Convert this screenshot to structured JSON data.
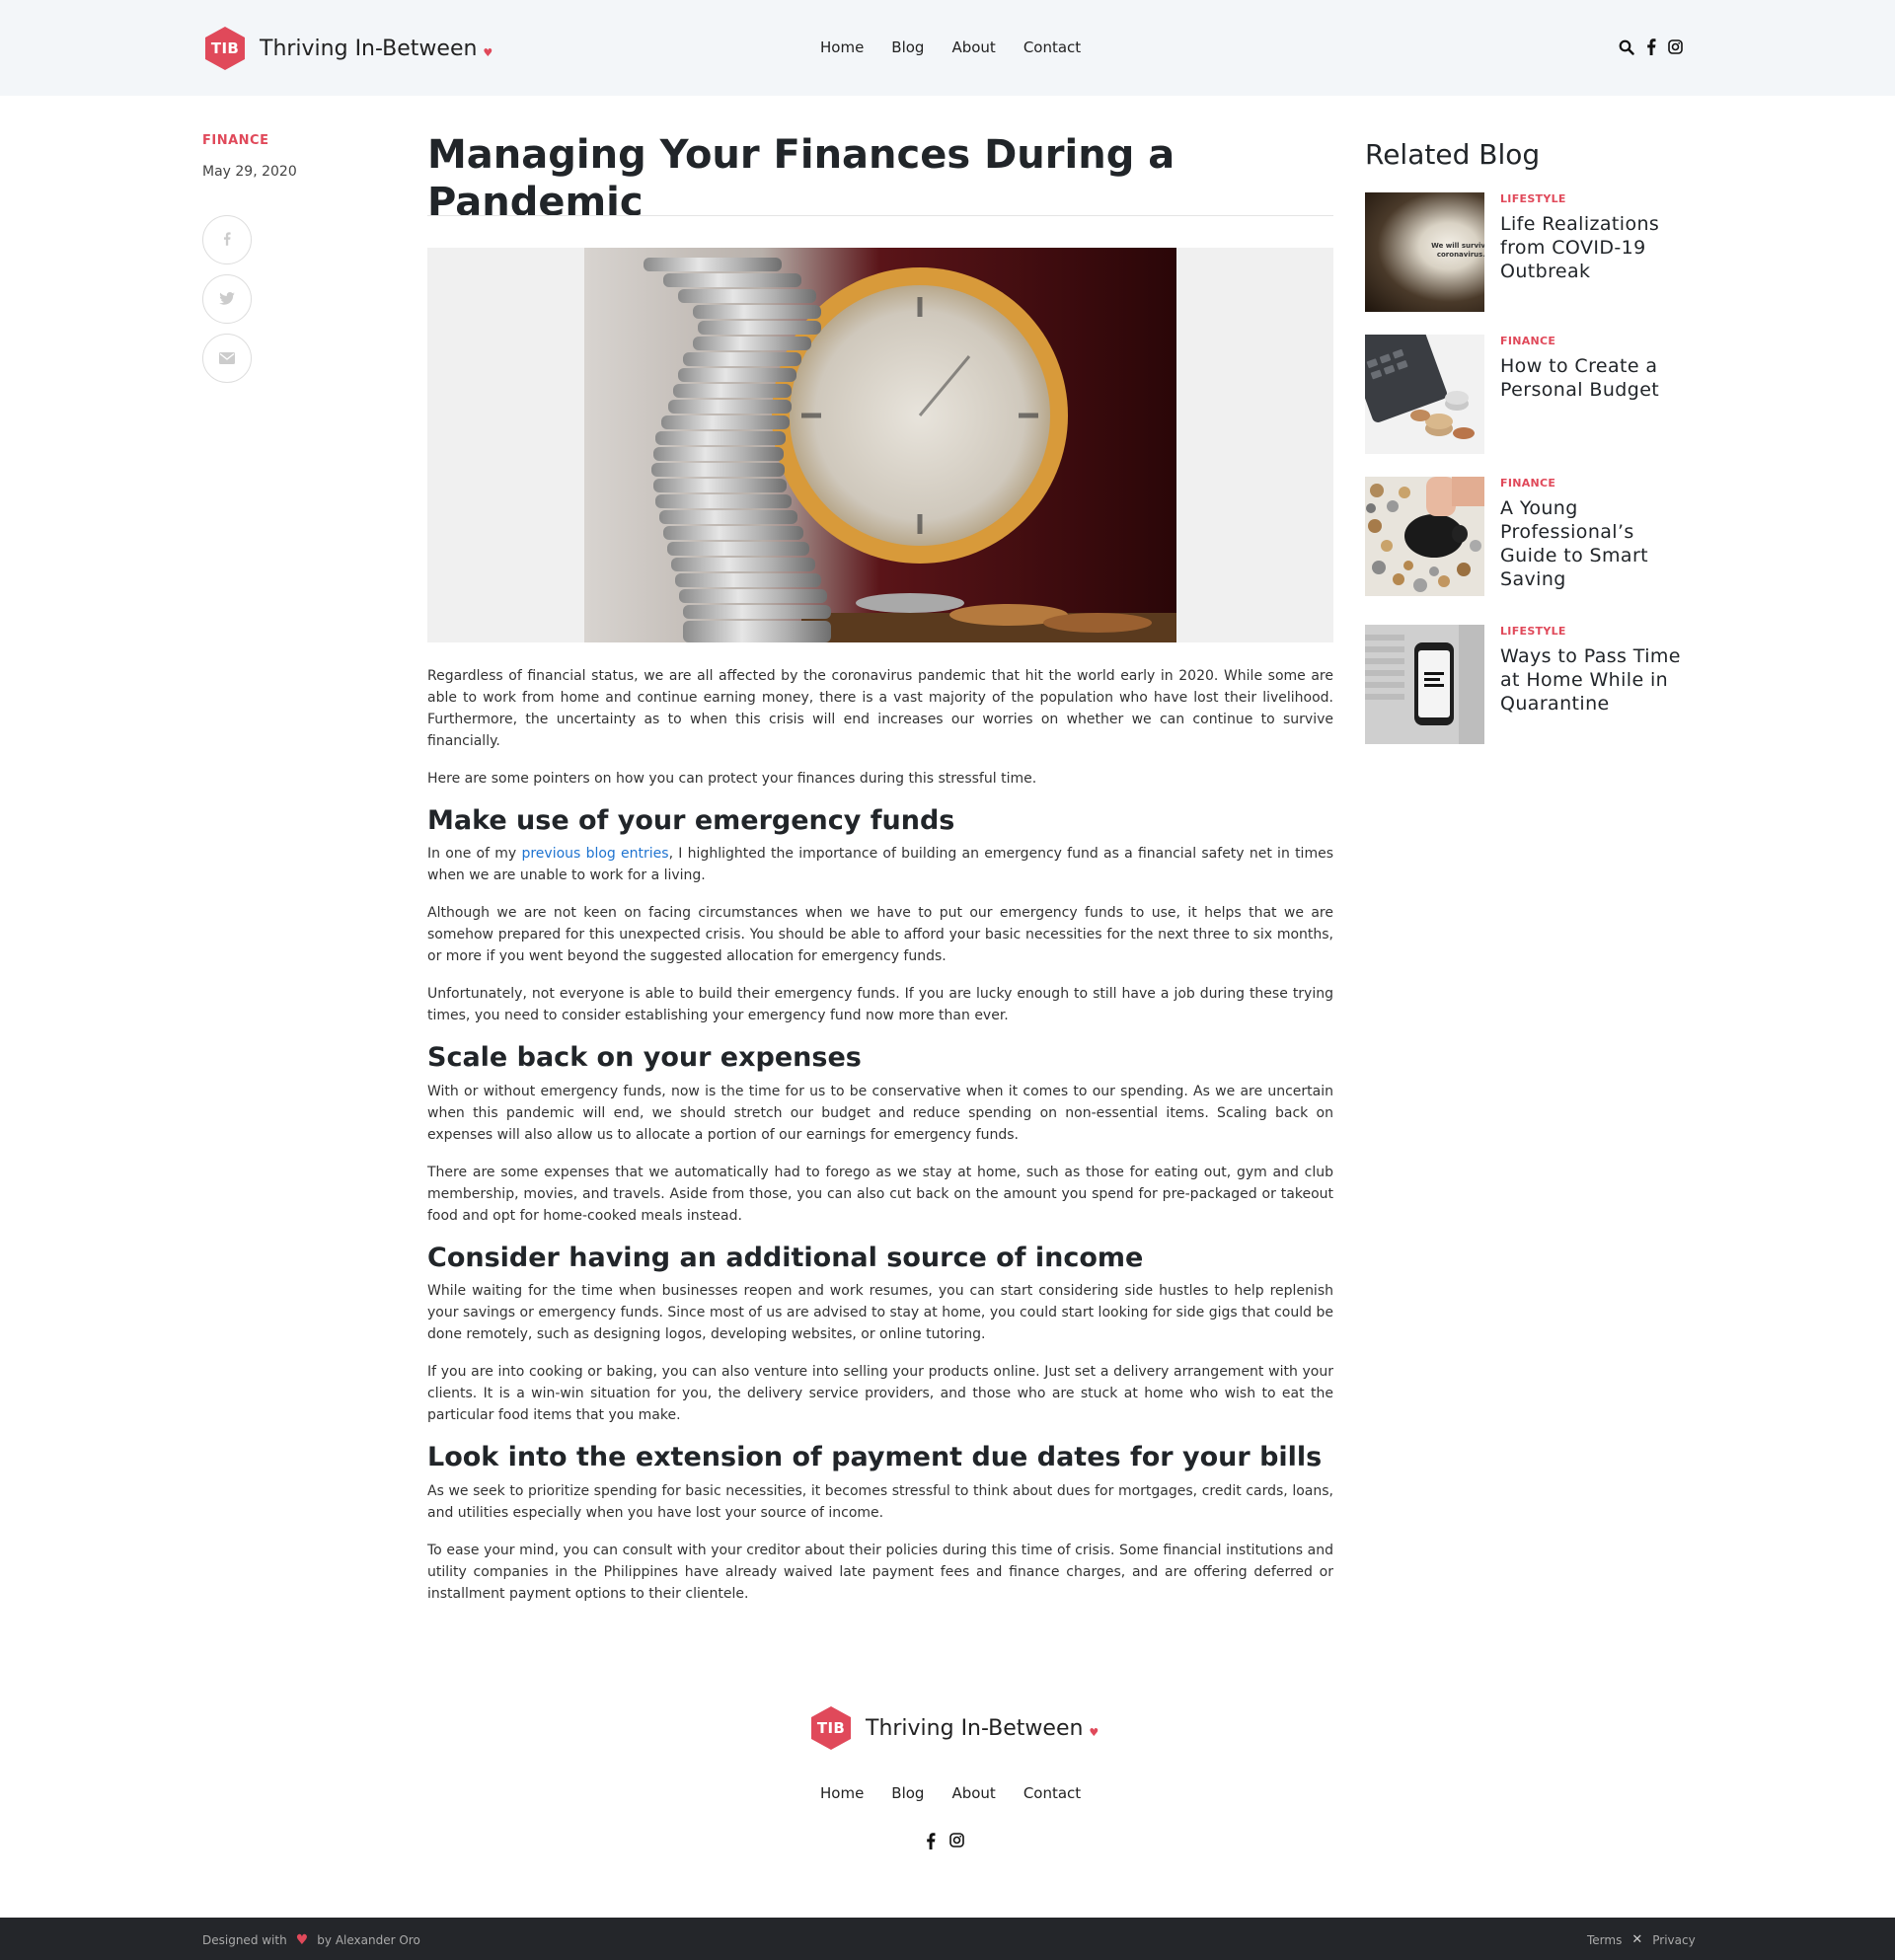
{
  "header": {
    "logo_text": "TIB",
    "brand": "Thriving In-Between",
    "nav": [
      "Home",
      "Blog",
      "About",
      "Contact"
    ],
    "icons": [
      "search-icon",
      "facebook-icon",
      "instagram-icon"
    ]
  },
  "meta": {
    "category": "FINANCE",
    "date": "May 29, 2020",
    "share_icons": [
      "facebook-icon",
      "twitter-icon",
      "email-icon"
    ]
  },
  "article": {
    "title": "Managing Your Finances During a Pandemic",
    "p1": "Regardless of financial status, we are all affected by the coronavirus pandemic that hit the world early in 2020. While some are able to work from home and continue earning money, there is a vast majority of the population who have lost their livelihood. Furthermore, the uncertainty as to when this crisis will end increases our worries on whether we can continue to survive financially.",
    "p2": "Here are some pointers on how you can protect your finances during this stressful time.",
    "h1": "Make use of your emergency funds",
    "p3_before": "In one of my ",
    "p3_link": "previous blog entries",
    "p3_after": ", I highlighted the importance of building an emergency fund as a financial safety net in times when we are unable to work for a living.",
    "p4": "Although we are not keen on facing circumstances when we have to put our emergency funds to use, it helps that we are somehow prepared for this unexpected crisis. You should be able to afford your basic necessities for the next three to six months, or more if you went beyond the suggested allocation for emergency funds.",
    "p5": "Unfortunately, not everyone is able to build their emergency funds. If you are lucky enough to still have a job during these trying times, you need to consider establishing your emergency fund now more than ever.",
    "h2": "Scale back on your expenses",
    "p6": "With or without emergency funds, now is the time for us to be conservative when it comes to our spending. As we are uncertain when this pandemic will end, we should stretch our budget and reduce spending on non-essential items. Scaling back on expenses will also allow us to allocate a portion of our earnings for emergency funds.",
    "p7": "There are some expenses that we automatically had to forego as we stay at home, such as those for eating out, gym and club membership, movies, and travels. Aside from those, you can also cut back on the amount you spend for pre-packaged or takeout food and opt for home-cooked meals instead.",
    "h3": "Consider having an additional source of income",
    "p8": "While waiting for the time when businesses reopen and work resumes, you can start considering side hustles to help replenish your savings or emergency funds. Since most of us are advised to stay at home, you could start looking for side gigs that could be done remotely, such as designing logos, developing websites, or online tutoring.",
    "p9": "If you are into cooking or baking, you can also venture into selling your products online. Just set a delivery arrangement with your clients. It is a win-win situation for you, the delivery service providers, and those who are stuck at home who wish to eat the particular food items that you make.",
    "h4": "Look into the extension of payment due dates for your bills",
    "p10": "As we seek to prioritize spending for basic necessities, it becomes stressful to think about dues for mortgages, credit cards, loans, and utilities especially when you have lost your source of income.",
    "p11": "To ease your mind, you can consult with your creditor about their policies during this time of crisis. Some financial institutions and utility companies in the Philippines have already waived late payment fees and finance charges, and are offering deferred or installment payment options to their clientele."
  },
  "related": {
    "heading": "Related Blog",
    "items": [
      {
        "category": "LIFESTYLE",
        "title": "Life Realizations from COVID-19 Outbreak",
        "thumb_text": "We will surviv coronavirus."
      },
      {
        "category": "FINANCE",
        "title": "How to Create a Personal Budget"
      },
      {
        "category": "FINANCE",
        "title": "A Young Professional’s Guide to Smart Saving"
      },
      {
        "category": "LIFESTYLE",
        "title": "Ways to Pass Time at Home While in Quarantine"
      }
    ]
  },
  "footer": {
    "logo_text": "TIB",
    "brand": "Thriving In-Between",
    "nav": [
      "Home",
      "Blog",
      "About",
      "Contact"
    ],
    "designed_with": "Designed with",
    "by": "by Alexander Oro",
    "terms": "Terms",
    "privacy": "Privacy"
  },
  "colors": {
    "accent": "#e0495a",
    "link": "#1e73d0",
    "header_bg": "#f3f6f9",
    "bottom_bar": "#24262a"
  }
}
